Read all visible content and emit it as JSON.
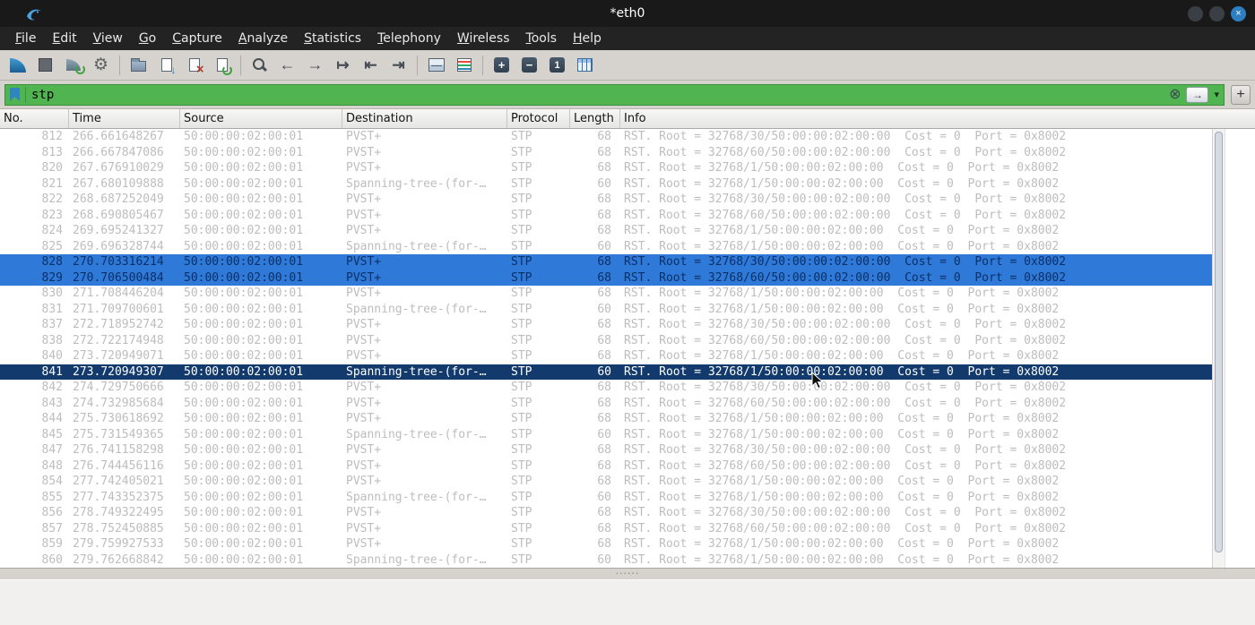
{
  "colors": {
    "titlebar_bg": "#191919",
    "menubar_bg": "#232323",
    "toolbar_bg": "#d6d2ce",
    "filter_valid_bg": "#50b450",
    "row_default_text": "#bdbdbd",
    "row_multiselect_bg": "#2f79d8",
    "row_multiselect_text": "#0b3068",
    "row_selected_bg": "#123a6d",
    "row_selected_text": "#ffffff",
    "accent_blue": "#2d7fc1"
  },
  "window": {
    "title": "*eth0",
    "controls": [
      "minimize",
      "maximize",
      "close"
    ]
  },
  "menu": {
    "items": [
      "File",
      "Edit",
      "View",
      "Go",
      "Capture",
      "Analyze",
      "Statistics",
      "Telephony",
      "Wireless",
      "Tools",
      "Help"
    ]
  },
  "toolbar": {
    "buttons": [
      "start-capture",
      "stop-capture",
      "restart-capture",
      "capture-options",
      "separator",
      "open-file",
      "save-file",
      "close-file",
      "reload-file",
      "separator",
      "find-packet",
      "previous-packet",
      "next-packet",
      "go-to-packet",
      "first-packet",
      "last-packet",
      "separator",
      "auto-scroll",
      "colorize",
      "separator",
      "zoom-in",
      "zoom-out",
      "zoom-original",
      "resize-columns"
    ]
  },
  "filter": {
    "value": "stp",
    "add_button_label": "+"
  },
  "packet_list": {
    "columns": [
      "No.",
      "Time",
      "Source",
      "Destination",
      "Protocol",
      "Length",
      "Info"
    ],
    "rows": [
      {
        "no": "812",
        "time": "266.661648267",
        "source": "50:00:00:02:00:01",
        "destination": "PVST+",
        "protocol": "STP",
        "length": "68",
        "info": "RST. Root = 32768/30/50:00:00:02:00:00  Cost = 0  Port = 0x8002",
        "state": "default"
      },
      {
        "no": "813",
        "time": "266.667847086",
        "source": "50:00:00:02:00:01",
        "destination": "PVST+",
        "protocol": "STP",
        "length": "68",
        "info": "RST. Root = 32768/60/50:00:00:02:00:00  Cost = 0  Port = 0x8002",
        "state": "default"
      },
      {
        "no": "820",
        "time": "267.676910029",
        "source": "50:00:00:02:00:01",
        "destination": "PVST+",
        "protocol": "STP",
        "length": "68",
        "info": "RST. Root = 32768/1/50:00:00:02:00:00  Cost = 0  Port = 0x8002",
        "state": "default"
      },
      {
        "no": "821",
        "time": "267.680109888",
        "source": "50:00:00:02:00:01",
        "destination": "Spanning-tree-(for-…",
        "protocol": "STP",
        "length": "60",
        "info": "RST. Root = 32768/1/50:00:00:02:00:00  Cost = 0  Port = 0x8002",
        "state": "default"
      },
      {
        "no": "822",
        "time": "268.687252049",
        "source": "50:00:00:02:00:01",
        "destination": "PVST+",
        "protocol": "STP",
        "length": "68",
        "info": "RST. Root = 32768/30/50:00:00:02:00:00  Cost = 0  Port = 0x8002",
        "state": "default"
      },
      {
        "no": "823",
        "time": "268.690805467",
        "source": "50:00:00:02:00:01",
        "destination": "PVST+",
        "protocol": "STP",
        "length": "68",
        "info": "RST. Root = 32768/60/50:00:00:02:00:00  Cost = 0  Port = 0x8002",
        "state": "default"
      },
      {
        "no": "824",
        "time": "269.695241327",
        "source": "50:00:00:02:00:01",
        "destination": "PVST+",
        "protocol": "STP",
        "length": "68",
        "info": "RST. Root = 32768/1/50:00:00:02:00:00  Cost = 0  Port = 0x8002",
        "state": "default"
      },
      {
        "no": "825",
        "time": "269.696328744",
        "source": "50:00:00:02:00:01",
        "destination": "Spanning-tree-(for-…",
        "protocol": "STP",
        "length": "60",
        "info": "RST. Root = 32768/1/50:00:00:02:00:00  Cost = 0  Port = 0x8002",
        "state": "default"
      },
      {
        "no": "828",
        "time": "270.703316214",
        "source": "50:00:00:02:00:01",
        "destination": "PVST+",
        "protocol": "STP",
        "length": "68",
        "info": "RST. Root = 32768/30/50:00:00:02:00:00  Cost = 0  Port = 0x8002",
        "state": "multiselect"
      },
      {
        "no": "829",
        "time": "270.706500484",
        "source": "50:00:00:02:00:01",
        "destination": "PVST+",
        "protocol": "STP",
        "length": "68",
        "info": "RST. Root = 32768/60/50:00:00:02:00:00  Cost = 0  Port = 0x8002",
        "state": "multiselect"
      },
      {
        "no": "830",
        "time": "271.708446204",
        "source": "50:00:00:02:00:01",
        "destination": "PVST+",
        "protocol": "STP",
        "length": "68",
        "info": "RST. Root = 32768/1/50:00:00:02:00:00  Cost = 0  Port = 0x8002",
        "state": "default"
      },
      {
        "no": "831",
        "time": "271.709700601",
        "source": "50:00:00:02:00:01",
        "destination": "Spanning-tree-(for-…",
        "protocol": "STP",
        "length": "60",
        "info": "RST. Root = 32768/1/50:00:00:02:00:00  Cost = 0  Port = 0x8002",
        "state": "default"
      },
      {
        "no": "837",
        "time": "272.718952742",
        "source": "50:00:00:02:00:01",
        "destination": "PVST+",
        "protocol": "STP",
        "length": "68",
        "info": "RST. Root = 32768/30/50:00:00:02:00:00  Cost = 0  Port = 0x8002",
        "state": "default"
      },
      {
        "no": "838",
        "time": "272.722174948",
        "source": "50:00:00:02:00:01",
        "destination": "PVST+",
        "protocol": "STP",
        "length": "68",
        "info": "RST. Root = 32768/60/50:00:00:02:00:00  Cost = 0  Port = 0x8002",
        "state": "default"
      },
      {
        "no": "840",
        "time": "273.720949071",
        "source": "50:00:00:02:00:01",
        "destination": "PVST+",
        "protocol": "STP",
        "length": "68",
        "info": "RST. Root = 32768/1/50:00:00:02:00:00  Cost = 0  Port = 0x8002",
        "state": "default"
      },
      {
        "no": "841",
        "time": "273.720949307",
        "source": "50:00:00:02:00:01",
        "destination": "Spanning-tree-(for-…",
        "protocol": "STP",
        "length": "60",
        "info": "RST. Root = 32768/1/50:00:00:02:00:00  Cost = 0  Port = 0x8002",
        "state": "selected"
      },
      {
        "no": "842",
        "time": "274.729750666",
        "source": "50:00:00:02:00:01",
        "destination": "PVST+",
        "protocol": "STP",
        "length": "68",
        "info": "RST. Root = 32768/30/50:00:00:02:00:00  Cost = 0  Port = 0x8002",
        "state": "default"
      },
      {
        "no": "843",
        "time": "274.732985684",
        "source": "50:00:00:02:00:01",
        "destination": "PVST+",
        "protocol": "STP",
        "length": "68",
        "info": "RST. Root = 32768/60/50:00:00:02:00:00  Cost = 0  Port = 0x8002",
        "state": "default"
      },
      {
        "no": "844",
        "time": "275.730618692",
        "source": "50:00:00:02:00:01",
        "destination": "PVST+",
        "protocol": "STP",
        "length": "68",
        "info": "RST. Root = 32768/1/50:00:00:02:00:00  Cost = 0  Port = 0x8002",
        "state": "default"
      },
      {
        "no": "845",
        "time": "275.731549365",
        "source": "50:00:00:02:00:01",
        "destination": "Spanning-tree-(for-…",
        "protocol": "STP",
        "length": "60",
        "info": "RST. Root = 32768/1/50:00:00:02:00:00  Cost = 0  Port = 0x8002",
        "state": "default"
      },
      {
        "no": "847",
        "time": "276.741158298",
        "source": "50:00:00:02:00:01",
        "destination": "PVST+",
        "protocol": "STP",
        "length": "68",
        "info": "RST. Root = 32768/30/50:00:00:02:00:00  Cost = 0  Port = 0x8002",
        "state": "default"
      },
      {
        "no": "848",
        "time": "276.744456116",
        "source": "50:00:00:02:00:01",
        "destination": "PVST+",
        "protocol": "STP",
        "length": "68",
        "info": "RST. Root = 32768/60/50:00:00:02:00:00  Cost = 0  Port = 0x8002",
        "state": "default"
      },
      {
        "no": "854",
        "time": "277.742405021",
        "source": "50:00:00:02:00:01",
        "destination": "PVST+",
        "protocol": "STP",
        "length": "68",
        "info": "RST. Root = 32768/1/50:00:00:02:00:00  Cost = 0  Port = 0x8002",
        "state": "default"
      },
      {
        "no": "855",
        "time": "277.743352375",
        "source": "50:00:00:02:00:01",
        "destination": "Spanning-tree-(for-…",
        "protocol": "STP",
        "length": "60",
        "info": "RST. Root = 32768/1/50:00:00:02:00:00  Cost = 0  Port = 0x8002",
        "state": "default"
      },
      {
        "no": "856",
        "time": "278.749322495",
        "source": "50:00:00:02:00:01",
        "destination": "PVST+",
        "protocol": "STP",
        "length": "68",
        "info": "RST. Root = 32768/30/50:00:00:02:00:00  Cost = 0  Port = 0x8002",
        "state": "default"
      },
      {
        "no": "857",
        "time": "278.752450885",
        "source": "50:00:00:02:00:01",
        "destination": "PVST+",
        "protocol": "STP",
        "length": "68",
        "info": "RST. Root = 32768/60/50:00:00:02:00:00  Cost = 0  Port = 0x8002",
        "state": "default"
      },
      {
        "no": "859",
        "time": "279.759927533",
        "source": "50:00:00:02:00:01",
        "destination": "PVST+",
        "protocol": "STP",
        "length": "68",
        "info": "RST. Root = 32768/1/50:00:00:02:00:00  Cost = 0  Port = 0x8002",
        "state": "default"
      },
      {
        "no": "860",
        "time": "279.762668842",
        "source": "50:00:00:02:00:01",
        "destination": "Spanning-tree-(for-…",
        "protocol": "STP",
        "length": "60",
        "info": "RST. Root = 32768/1/50:00:00:02:00:00  Cost = 0  Port = 0x8002",
        "state": "default"
      }
    ]
  }
}
